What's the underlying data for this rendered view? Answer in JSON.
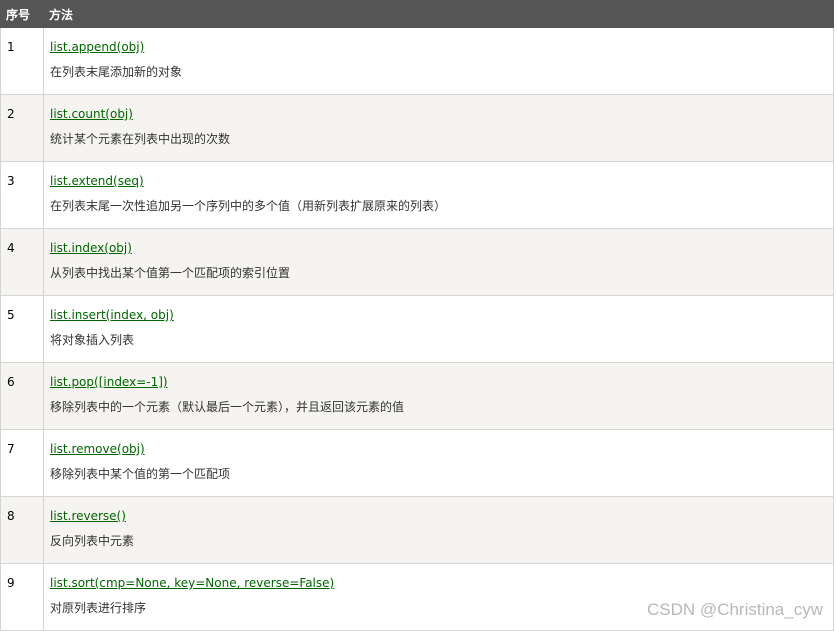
{
  "table": {
    "headers": {
      "index": "序号",
      "method": "方法"
    },
    "rows": [
      {
        "index": "1",
        "method": "list.append(obj)",
        "description": "在列表末尾添加新的对象"
      },
      {
        "index": "2",
        "method": "list.count(obj)",
        "description": "统计某个元素在列表中出现的次数"
      },
      {
        "index": "3",
        "method": "list.extend(seq)",
        "description": "在列表末尾一次性追加另一个序列中的多个值（用新列表扩展原来的列表）"
      },
      {
        "index": "4",
        "method": "list.index(obj)",
        "description": "从列表中找出某个值第一个匹配项的索引位置"
      },
      {
        "index": "5",
        "method": "list.insert(index, obj)",
        "description": "将对象插入列表"
      },
      {
        "index": "6",
        "method": "list.pop([index=-1])",
        "description": "移除列表中的一个元素（默认最后一个元素），并且返回该元素的值"
      },
      {
        "index": "7",
        "method": "list.remove(obj)",
        "description": "移除列表中某个值的第一个匹配项"
      },
      {
        "index": "8",
        "method": "list.reverse()",
        "description": "反向列表中元素"
      },
      {
        "index": "9",
        "method": "list.sort(cmp=None, key=None, reverse=False)",
        "description": "对原列表进行排序"
      }
    ]
  },
  "watermark": "CSDN @Christina_cyw",
  "colors": {
    "header_bg": "#555555",
    "header_text": "#ffffff",
    "row_alt_bg": "#f6f4f0",
    "link": "#006600",
    "border": "#d4d4d4"
  }
}
